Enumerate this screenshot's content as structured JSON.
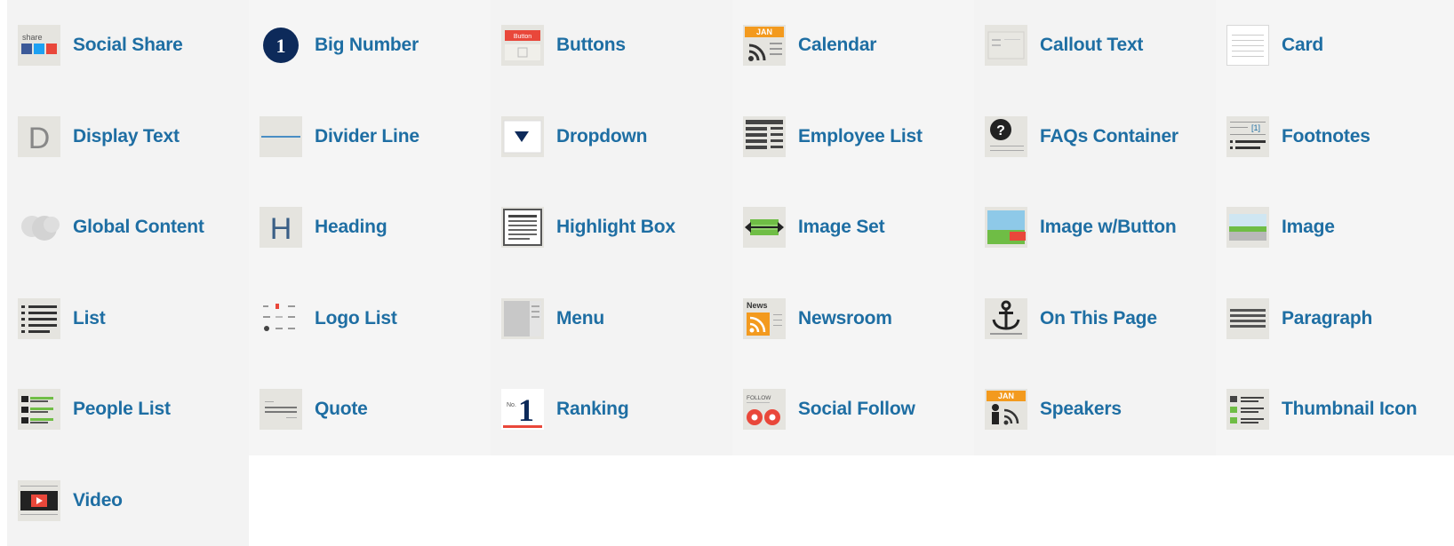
{
  "widgets": [
    {
      "label": "Social Share",
      "icon": "social-share-icon"
    },
    {
      "label": "Big Number",
      "icon": "big-number-icon"
    },
    {
      "label": "Buttons",
      "icon": "buttons-icon"
    },
    {
      "label": "Calendar",
      "icon": "calendar-icon"
    },
    {
      "label": "Callout Text",
      "icon": "callout-text-icon"
    },
    {
      "label": "Card",
      "icon": "card-icon"
    },
    {
      "label": "Display Text",
      "icon": "display-text-icon"
    },
    {
      "label": "Divider Line",
      "icon": "divider-line-icon"
    },
    {
      "label": "Dropdown",
      "icon": "dropdown-icon"
    },
    {
      "label": "Employee List",
      "icon": "employee-list-icon"
    },
    {
      "label": "FAQs Container",
      "icon": "faqs-container-icon"
    },
    {
      "label": "Footnotes",
      "icon": "footnotes-icon"
    },
    {
      "label": "Global Content",
      "icon": "global-content-icon"
    },
    {
      "label": "Heading",
      "icon": "heading-icon"
    },
    {
      "label": "Highlight Box",
      "icon": "highlight-box-icon"
    },
    {
      "label": "Image Set",
      "icon": "image-set-icon"
    },
    {
      "label": "Image w/Button",
      "icon": "image-with-button-icon"
    },
    {
      "label": "Image",
      "icon": "image-icon"
    },
    {
      "label": "List",
      "icon": "list-icon"
    },
    {
      "label": "Logo List",
      "icon": "logo-list-icon"
    },
    {
      "label": "Menu",
      "icon": "menu-icon"
    },
    {
      "label": "Newsroom",
      "icon": "newsroom-icon"
    },
    {
      "label": "On This Page",
      "icon": "anchor-icon"
    },
    {
      "label": "Paragraph",
      "icon": "paragraph-icon"
    },
    {
      "label": "People List",
      "icon": "people-list-icon"
    },
    {
      "label": "Quote",
      "icon": "quote-icon"
    },
    {
      "label": "Ranking",
      "icon": "ranking-icon"
    },
    {
      "label": "Social Follow",
      "icon": "social-follow-icon"
    },
    {
      "label": "Speakers",
      "icon": "speakers-icon"
    },
    {
      "label": "Thumbnail Icon",
      "icon": "thumbnail-icon-icon"
    },
    {
      "label": "Video",
      "icon": "video-icon"
    }
  ],
  "icon_text": {
    "share": "share",
    "buttons": "Button",
    "calendar_month": "JAN",
    "news": "News",
    "follow": "FOLLOW",
    "speakers_month": "JAN",
    "big_number": "1",
    "faq": "?",
    "display_letter": "D",
    "heading_letter": "H",
    "ranking_prefix": "No.",
    "ranking_number": "1",
    "footnote_mark": "[1]"
  },
  "colors": {
    "label": "#1e6ea3",
    "tile_bg": "#f2f2f2",
    "icon_bg": "#e5e4df",
    "orange": "#f39a1e",
    "red": "#e9473a",
    "navy": "#0d2a5a",
    "green": "#6fbd45"
  }
}
